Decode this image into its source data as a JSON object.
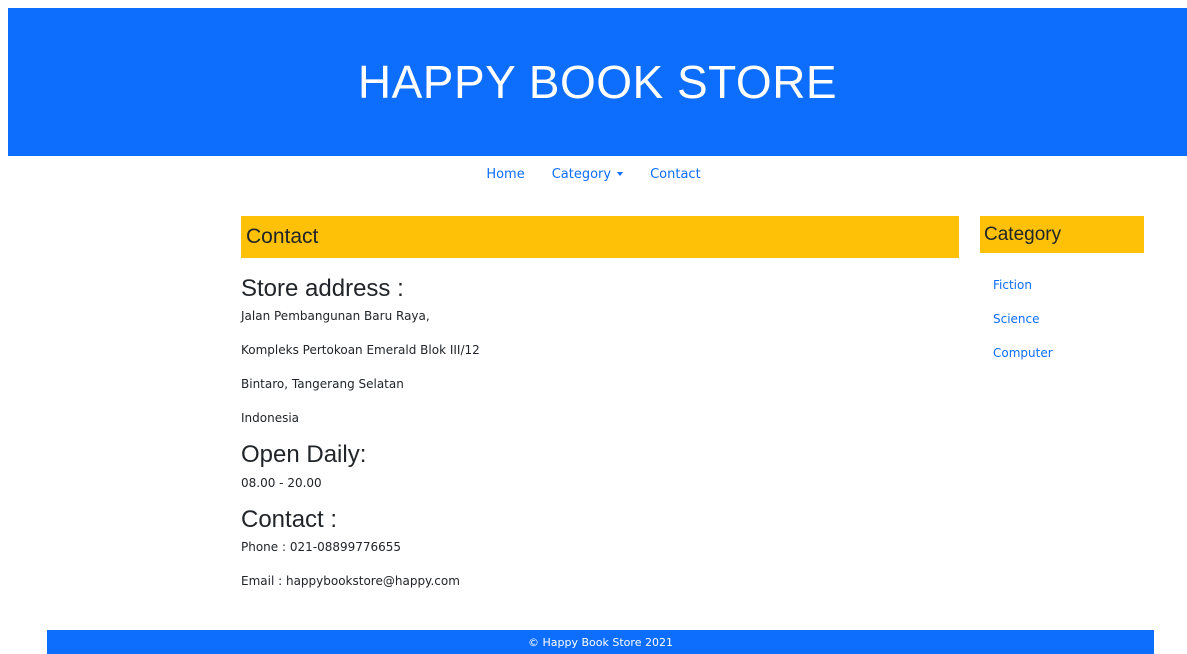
{
  "header": {
    "title": "HAPPY BOOK STORE"
  },
  "nav": {
    "items": [
      {
        "label": "Home"
      },
      {
        "label": "Category",
        "has_dropdown": true
      },
      {
        "label": "Contact"
      }
    ]
  },
  "main": {
    "heading": "Contact",
    "sections": [
      {
        "title": "Store address :",
        "lines": [
          "Jalan Pembangunan Baru Raya,",
          "Kompleks Pertokoan Emerald Blok III/12",
          "Bintaro, Tangerang Selatan",
          "Indonesia"
        ]
      },
      {
        "title": "Open Daily:",
        "lines": [
          "08.00 - 20.00"
        ]
      },
      {
        "title": "Contact :",
        "lines": [
          "Phone : 021-08899776655",
          "Email : happybookstore@happy.com"
        ]
      }
    ]
  },
  "sidebar": {
    "heading": "Category",
    "items": [
      {
        "label": "Fiction"
      },
      {
        "label": "Science"
      },
      {
        "label": "Computer"
      }
    ]
  },
  "footer": {
    "text": "© Happy Book Store 2021"
  },
  "colors": {
    "primary": "#0d6efd",
    "accent": "#ffc107",
    "text": "#212529",
    "background": "#ffffff"
  }
}
